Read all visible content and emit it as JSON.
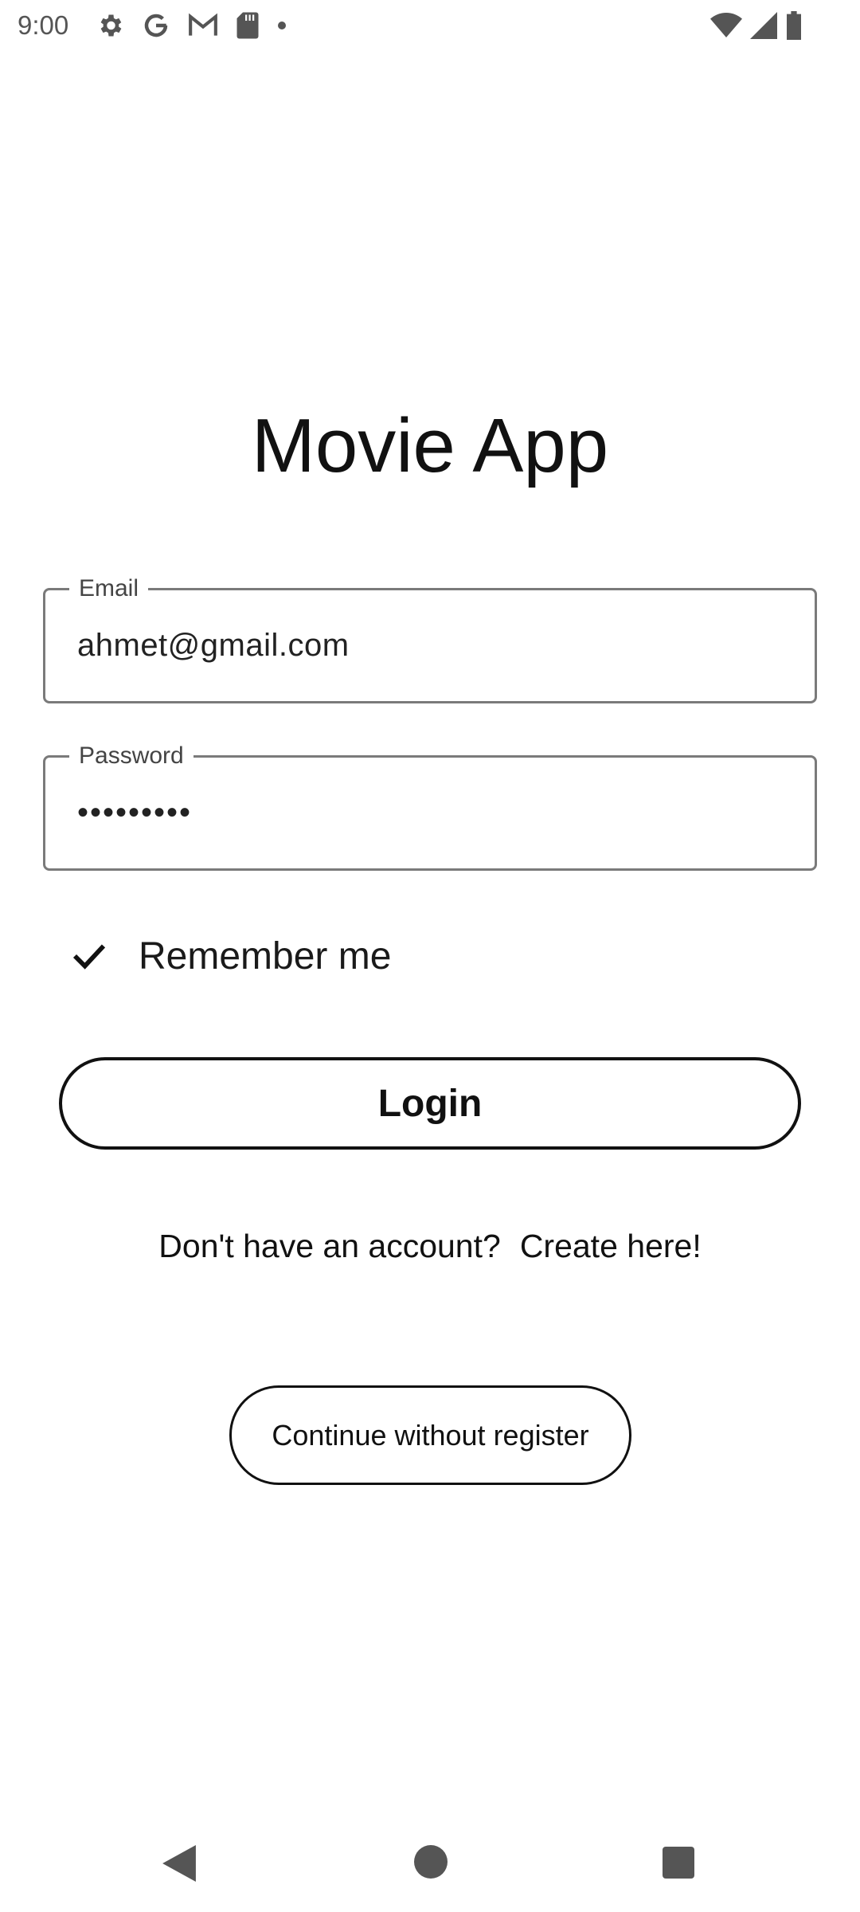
{
  "status_bar": {
    "time": "9:00",
    "left_icons": [
      "settings-icon",
      "google-icon",
      "gmail-icon",
      "sd-card-icon",
      "dot-icon"
    ],
    "right_icons": [
      "wifi-icon",
      "cell-signal-icon",
      "battery-icon"
    ]
  },
  "title": "Movie App",
  "email_field": {
    "label": "Email",
    "value": "ahmet@gmail.com"
  },
  "password_field": {
    "label": "Password",
    "masked_value": "•••••••••"
  },
  "remember_me": {
    "label": "Remember me",
    "checked": true
  },
  "login_button": {
    "label": "Login"
  },
  "register": {
    "prompt": "Don't have an account?",
    "link": "Create here!"
  },
  "continue_button": {
    "label": "Continue without register"
  },
  "nav_bar": {
    "buttons": [
      "back-icon",
      "home-icon",
      "recents-icon"
    ]
  }
}
